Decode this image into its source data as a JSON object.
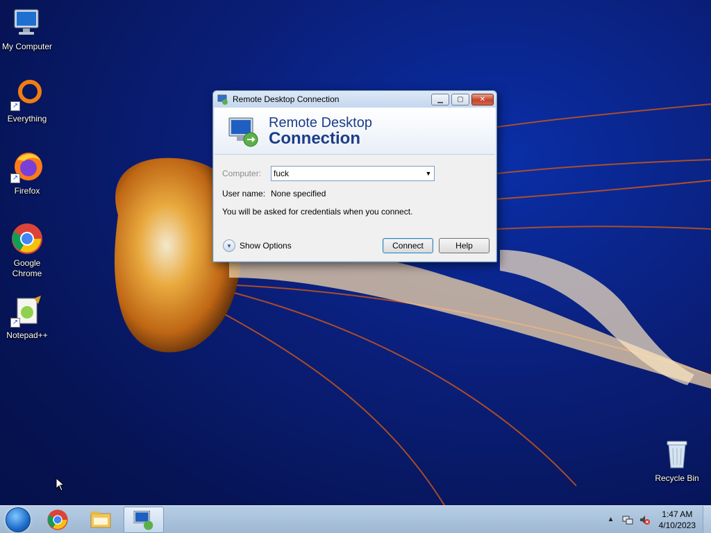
{
  "desktop": {
    "icons": [
      {
        "label": "My Computer"
      },
      {
        "label": "Everything"
      },
      {
        "label": "Firefox"
      },
      {
        "label": "Google Chrome"
      },
      {
        "label": "Notepad++"
      },
      {
        "label": "Recycle Bin"
      }
    ]
  },
  "dialog": {
    "title": "Remote Desktop Connection",
    "banner_line1": "Remote Desktop",
    "banner_line2": "Connection",
    "computer_label": "Computer:",
    "computer_value": "fuck",
    "username_label": "User name:",
    "username_value": "None specified",
    "note": "You will be asked for credentials when you connect.",
    "show_options_label": "Show Options",
    "connect_label": "Connect",
    "help_label": "Help"
  },
  "taskbar": {
    "time": "1:47 AM",
    "date": "4/10/2023",
    "tray_up_arrow": "▲"
  },
  "colors": {
    "banner_text": "#1c3d8a",
    "taskbar": "#b6cde4"
  },
  "icon_names": [
    "computer-icon",
    "everything-icon",
    "firefox-icon",
    "chrome-icon",
    "notepadpp-icon",
    "recycle-bin-icon",
    "remote-desktop-icon",
    "folder-icon",
    "network-icon",
    "volume-muted-icon",
    "start-orb-icon"
  ]
}
